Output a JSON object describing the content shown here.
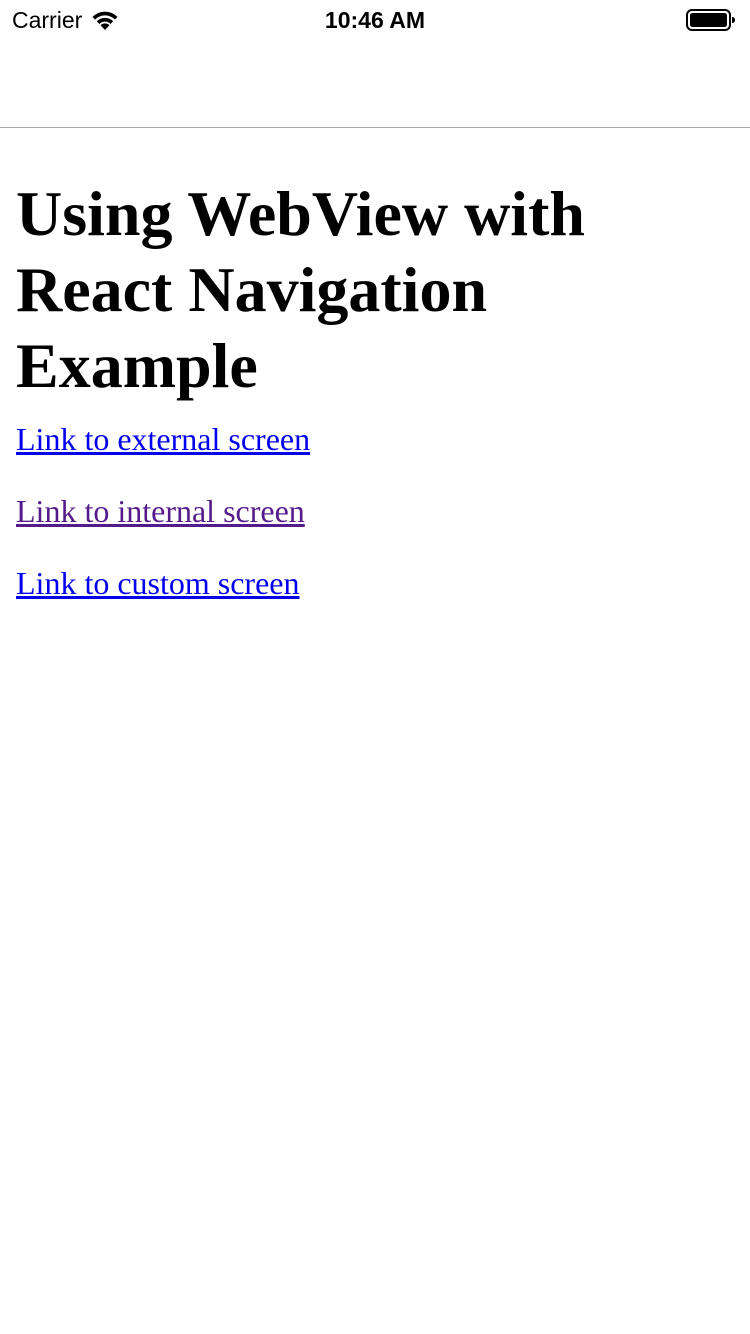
{
  "status_bar": {
    "carrier": "Carrier",
    "time": "10:46 AM"
  },
  "content": {
    "title": "Using WebView with React Navigation Example",
    "links": [
      {
        "label": "Link to external screen",
        "color": "#0000ee"
      },
      {
        "label": "Link to internal screen",
        "color": "#551a8b"
      },
      {
        "label": "Link to custom screen",
        "color": "#0000ee"
      }
    ]
  }
}
